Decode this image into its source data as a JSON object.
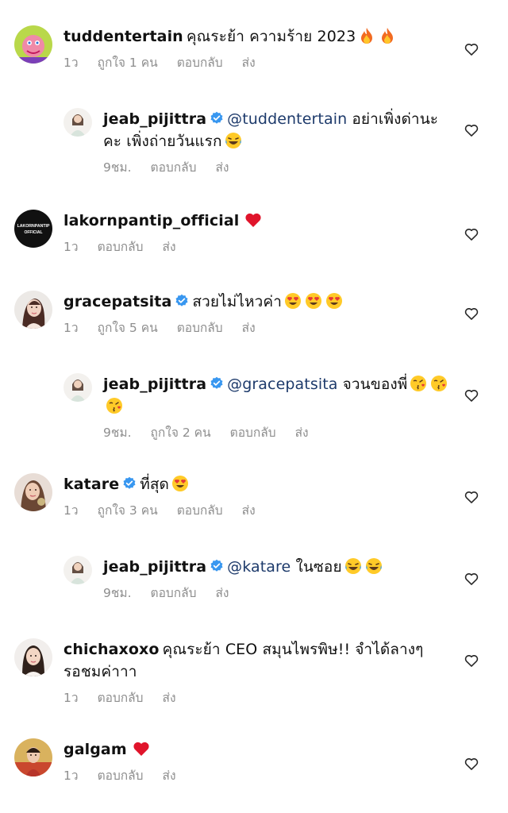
{
  "comments": [
    {
      "id": "c1",
      "type": "comment",
      "username": "tuddentertain",
      "verified": false,
      "text": "คุณระย้า ความร้าย 2023",
      "emojis": [
        "fire",
        "fire"
      ],
      "time": "1ว",
      "likes": "ถูกใจ 1 คน",
      "reply_label": "ตอบกลับ",
      "send_label": "ส่ง"
    },
    {
      "id": "c2",
      "type": "reply",
      "username": "jeab_pijittra",
      "verified": true,
      "mention": "@tuddentertain",
      "text": "อย่าเพิ่งด่านะคะ เพิ่งถ่ายวันแรก",
      "emojis": [
        "laugh"
      ],
      "time": "9ชม.",
      "reply_label": "ตอบกลับ",
      "send_label": "ส่ง"
    },
    {
      "id": "c3",
      "type": "comment",
      "username": "lakornpantip_official",
      "verified": false,
      "text": "",
      "emojis": [
        "heart"
      ],
      "time": "1ว",
      "reply_label": "ตอบกลับ",
      "send_label": "ส่ง",
      "avatar_text": "LAKORNPANTIP OFFICIAL"
    },
    {
      "id": "c4",
      "type": "comment",
      "username": "gracepatsita",
      "verified": true,
      "text": "สวยไม่ไหวค่า",
      "emojis": [
        "hearteyes",
        "hearteyes",
        "hearteyes"
      ],
      "time": "1ว",
      "likes": "ถูกใจ 5 คน",
      "reply_label": "ตอบกลับ",
      "send_label": "ส่ง"
    },
    {
      "id": "c5",
      "type": "reply",
      "username": "jeab_pijittra",
      "verified": true,
      "mention": "@gracepatsita",
      "text": "จวนของพี่",
      "emojis": [
        "kiss",
        "kiss",
        "kiss"
      ],
      "time": "9ชม.",
      "likes": "ถูกใจ 2 คน",
      "reply_label": "ตอบกลับ",
      "send_label": "ส่ง"
    },
    {
      "id": "c6",
      "type": "comment",
      "username": "katare",
      "verified": true,
      "text": "ที่สุด",
      "emojis": [
        "hearteyes"
      ],
      "time": "1ว",
      "likes": "ถูกใจ 3 คน",
      "reply_label": "ตอบกลับ",
      "send_label": "ส่ง"
    },
    {
      "id": "c7",
      "type": "reply",
      "username": "jeab_pijittra",
      "verified": true,
      "mention": "@katare",
      "text": "ในซอย",
      "emojis": [
        "laugh",
        "laugh"
      ],
      "time": "9ชม.",
      "reply_label": "ตอบกลับ",
      "send_label": "ส่ง"
    },
    {
      "id": "c8",
      "type": "comment",
      "username": "chichaxoxo",
      "verified": false,
      "text": "คุณระย้า CEO สมุนไพรพิษ!! จำได้ลางๆ รอชมค่าาา",
      "emojis": [],
      "time": "1ว",
      "reply_label": "ตอบกลับ",
      "send_label": "ส่ง"
    },
    {
      "id": "c9",
      "type": "comment",
      "username": "galgam",
      "verified": false,
      "text": "",
      "emojis": [
        "heart"
      ],
      "time": "1ว",
      "reply_label": "ตอบกลับ",
      "send_label": "ส่ง"
    }
  ],
  "colors": {
    "meta": "#8e8e8e",
    "mention": "#1d3a6b",
    "verified": "#3897f0",
    "heart_outline": "#262626"
  }
}
